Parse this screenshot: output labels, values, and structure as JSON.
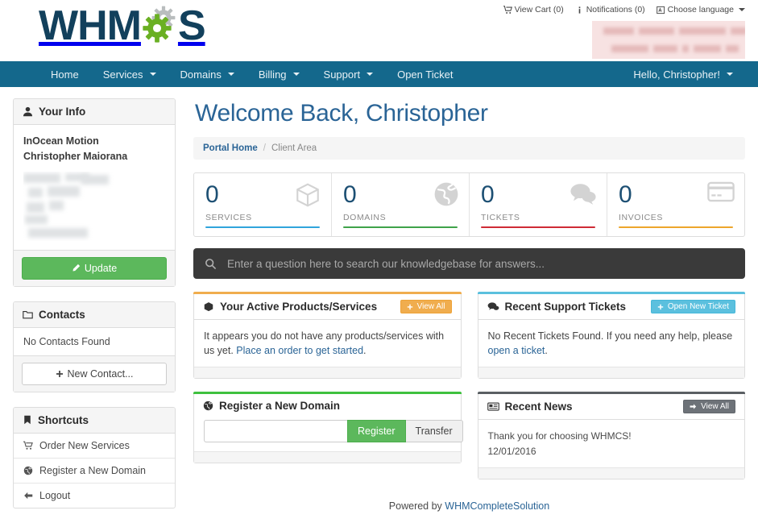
{
  "brand": {
    "logo_text_left": "WHM",
    "logo_text_right": "S",
    "navbar_color": "#14688c",
    "logo_color": "#12405c",
    "gear_green": "#6ab023",
    "gear_gray": "#b9bdbe"
  },
  "header": {
    "links": [
      {
        "icon": "cart-icon",
        "label": "View Cart (0)"
      },
      {
        "icon": "info-icon",
        "label": "Notifications (0)"
      },
      {
        "icon": "language-icon",
        "label": "Choose language",
        "caret": true
      }
    ]
  },
  "navbar": {
    "items": [
      {
        "label": "Home",
        "caret": false
      },
      {
        "label": "Services",
        "caret": true
      },
      {
        "label": "Domains",
        "caret": true
      },
      {
        "label": "Billing",
        "caret": true
      },
      {
        "label": "Support",
        "caret": true
      },
      {
        "label": "Open Ticket",
        "caret": false
      }
    ],
    "account": {
      "label": "Hello, Christopher!",
      "caret": true
    }
  },
  "sidebar": {
    "your_info": {
      "title": "Your Info",
      "icon": "user-icon",
      "company": "InOcean Motion",
      "name": "Christopher Maiorana",
      "update_label": "Update",
      "update_icon": "pencil-icon"
    },
    "contacts": {
      "title": "Contacts",
      "icon": "folder-icon",
      "empty_text": "No Contacts Found",
      "new_contact_label": "New Contact..."
    },
    "shortcuts": {
      "title": "Shortcuts",
      "icon": "bookmark-icon",
      "items": [
        {
          "icon": "cart-icon",
          "label": "Order New Services"
        },
        {
          "icon": "globe-icon",
          "label": "Register a New Domain"
        },
        {
          "icon": "arrow-left-icon",
          "label": "Logout"
        }
      ]
    }
  },
  "main": {
    "page_title": "Welcome Back, Christopher",
    "breadcrumb": {
      "home": "Portal Home",
      "separator": "/",
      "current": "Client Area"
    },
    "stats": [
      {
        "value": "0",
        "label": "SERVICES",
        "color": "#30a5dc",
        "icon": "box-icon"
      },
      {
        "value": "0",
        "label": "DOMAINS",
        "color": "#3fa34a",
        "icon": "globe-icon"
      },
      {
        "value": "0",
        "label": "TICKETS",
        "color": "#cf2b36",
        "icon": "comments-icon"
      },
      {
        "value": "0",
        "label": "INVOICES",
        "color": "#eda62c",
        "icon": "credit-card-icon"
      }
    ],
    "search": {
      "placeholder": "Enter a question here to search our knowledgebase for answers...",
      "icon": "search-icon"
    },
    "products": {
      "title": "Your Active Products/Services",
      "icon": "box-icon",
      "button_label": "View All",
      "accent": "#f0ad4e",
      "text_before": "It appears you do not have any products/services with us yet. ",
      "link_text": "Place an order to get started",
      "text_after": "."
    },
    "tickets": {
      "title": "Recent Support Tickets",
      "icon": "comments-icon",
      "button_label": "Open New Ticket",
      "accent": "#5bc0de",
      "text_before": "No Recent Tickets Found. If you need any help, please ",
      "link_text": "open a ticket",
      "text_after": "."
    },
    "domain": {
      "title": "Register a New Domain",
      "icon": "globe-icon",
      "accent": "#3fc13f",
      "input_value": "",
      "input_placeholder": "",
      "register_label": "Register",
      "transfer_label": "Transfer"
    },
    "news": {
      "title": "Recent News",
      "icon": "newspaper-icon",
      "button_label": "View All",
      "accent": "#5a5f63",
      "headline": "Thank you for choosing WHMCS!",
      "date": "12/01/2016"
    }
  },
  "footer": {
    "prefix": "Powered by ",
    "link": "WHMCompleteSolution"
  }
}
